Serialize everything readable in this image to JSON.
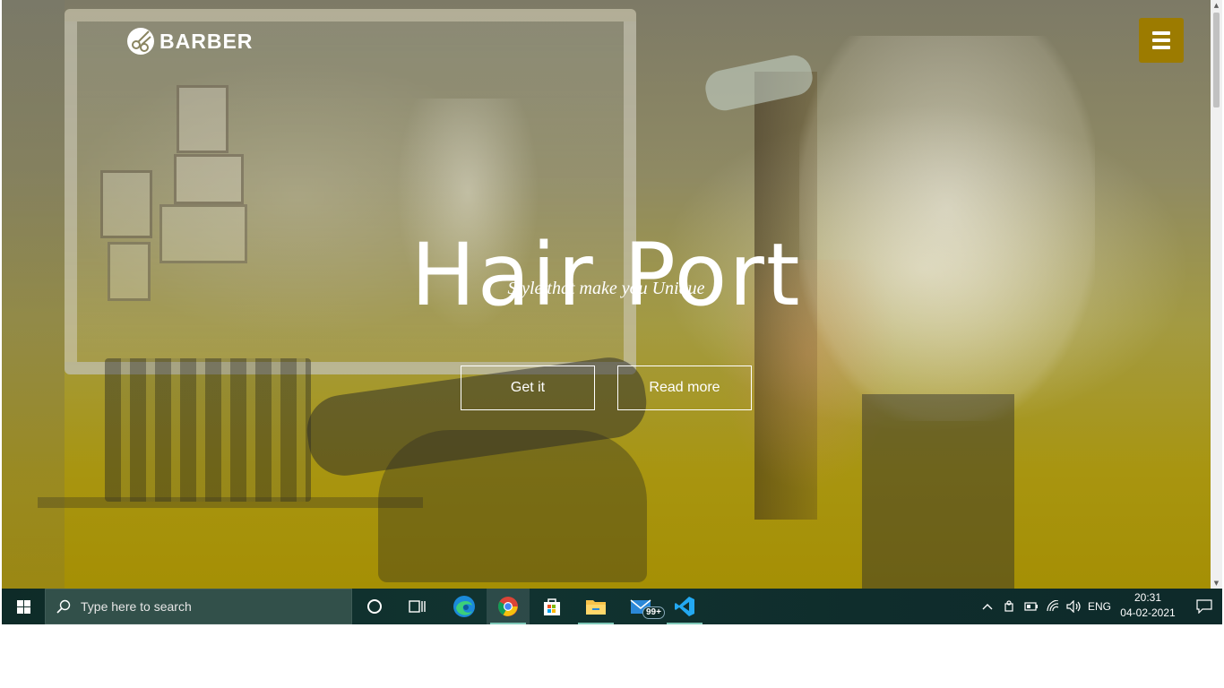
{
  "site": {
    "logo_text": "BARBER",
    "title": "Hair Port",
    "tagline": "Style that make you Unique",
    "buttons": {
      "primary": "Get it",
      "secondary": "Read more"
    },
    "menu_icon": "hamburger-menu-icon",
    "accent_color": "#9c7b00",
    "overlay_color": "#a58f04"
  },
  "taskbar": {
    "search_placeholder": "Type here to search",
    "apps": [
      "cortana",
      "task-view",
      "edge",
      "chrome",
      "microsoft-store",
      "file-explorer",
      "mail",
      "vscode"
    ],
    "mail_badge": "99+",
    "language": "ENG",
    "time": "20:31",
    "date": "04-02-2021"
  }
}
